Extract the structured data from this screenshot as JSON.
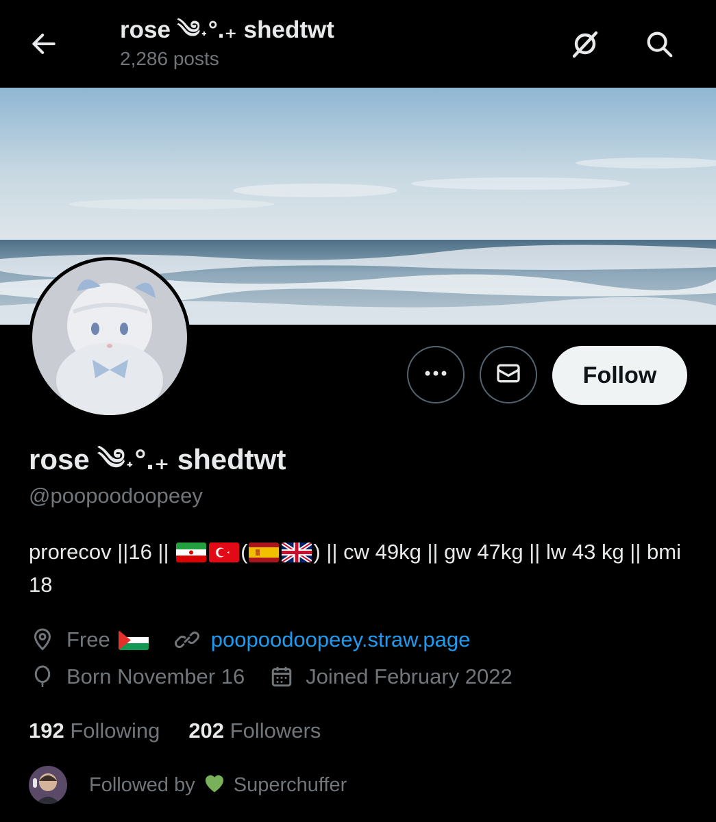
{
  "header": {
    "title": "rose ༄˖°.₊ shedtwt",
    "post_count": "2,286 posts"
  },
  "profile": {
    "display_name": "rose ༄˖°.₊ shedtwt",
    "handle": "@poopoodoopeey",
    "follow_label": "Follow",
    "bio": {
      "part1": "prorecov ||16 || ",
      "paren_open": "(",
      "paren_close": ")",
      "part2": " || cw 49kg || gw 47kg || lw 43 kg || bmi 18"
    },
    "location": "Free",
    "website": "poopoodoopeey.straw.page",
    "birthday": "Born November 16",
    "joined": "Joined February 2022"
  },
  "stats": {
    "following_count": "192",
    "following_label": "Following",
    "followers_count": "202",
    "followers_label": "Followers"
  },
  "followed_by": {
    "prefix": "Followed by",
    "name": "Superchuffer"
  },
  "colors": {
    "background": "#000000",
    "text_primary": "#e7e9ea",
    "text_secondary": "#71767b",
    "link": "#1d9bf0",
    "button_border": "#536471",
    "follow_button_bg": "#eff3f4"
  },
  "icons": {
    "back": "arrow-left-icon",
    "grok": "grok-icon",
    "search": "search-icon",
    "more": "more-dots-icon",
    "message": "envelope-icon",
    "location": "location-pin-icon",
    "link": "link-icon",
    "birthday": "balloon-icon",
    "joined": "calendar-icon",
    "heart": "green-heart-icon"
  }
}
